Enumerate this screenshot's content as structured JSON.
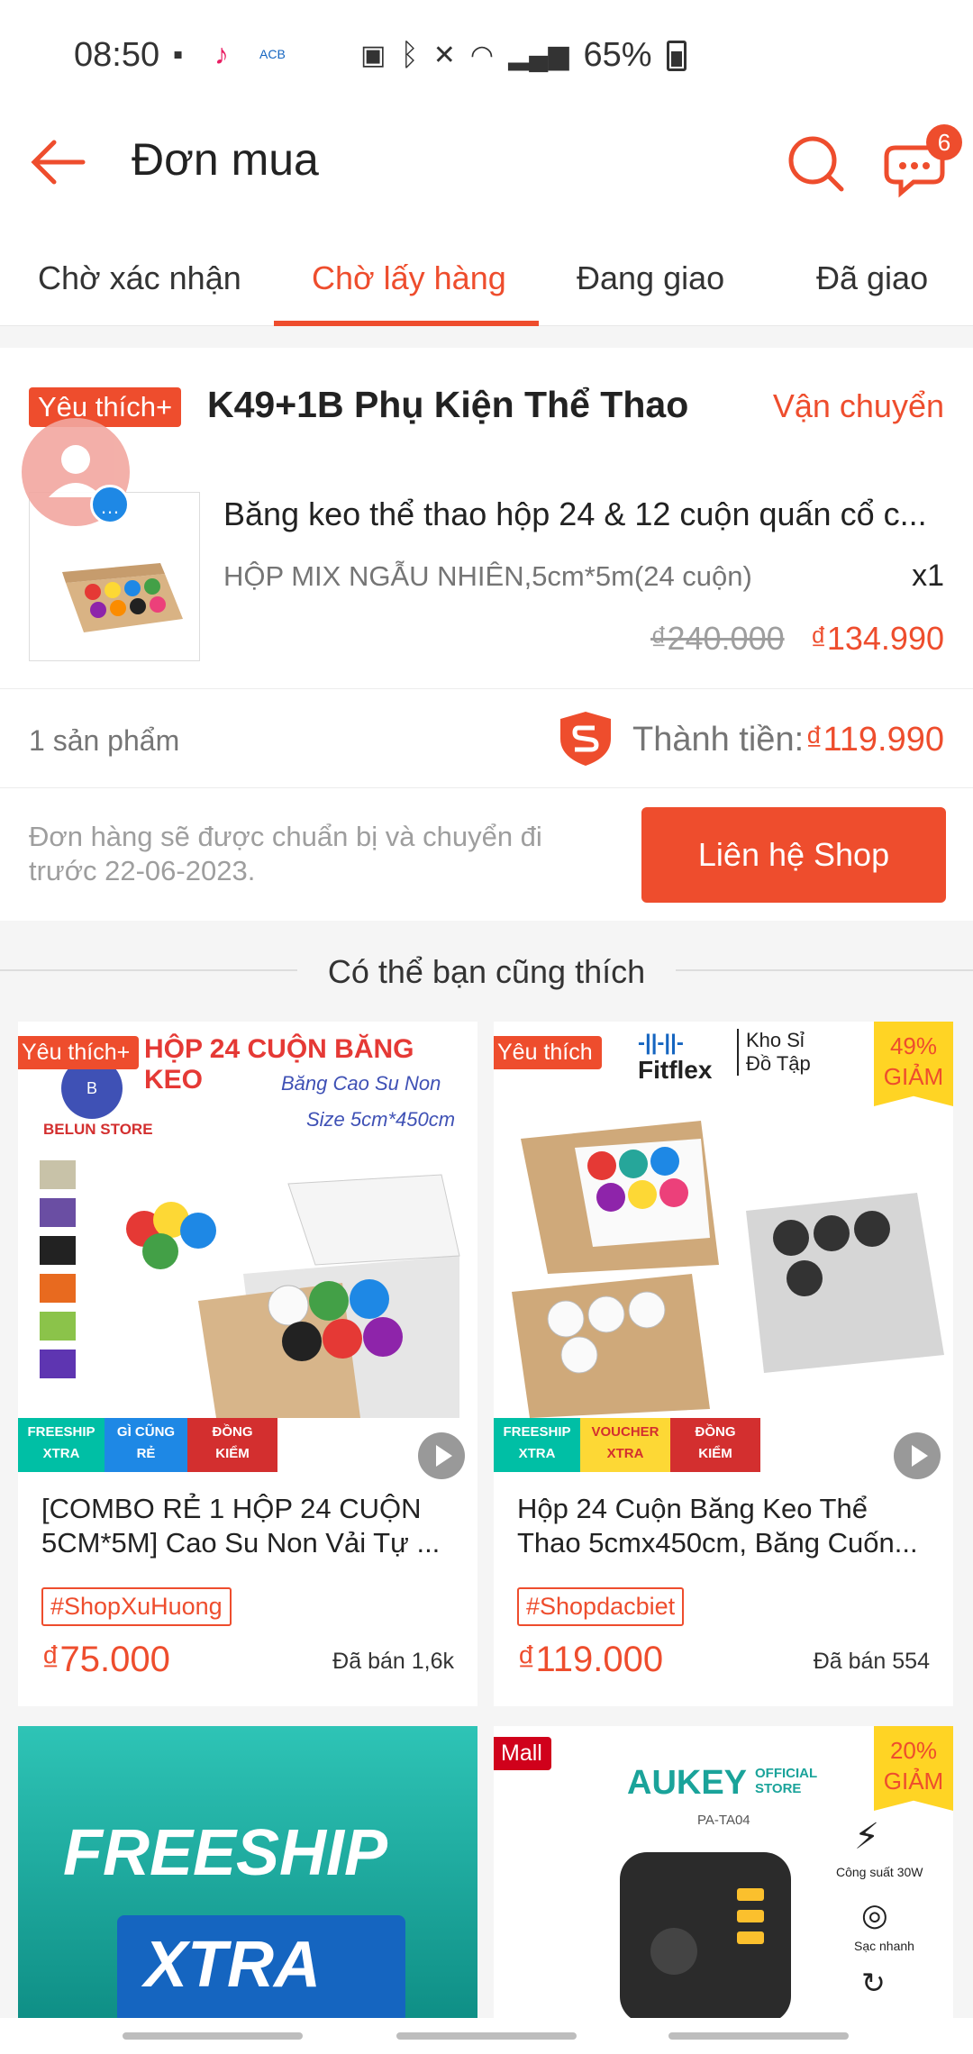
{
  "status_bar": {
    "time": "08:50",
    "battery": "65%"
  },
  "header": {
    "title": "Đơn mua",
    "chat_badge": "6"
  },
  "tabs": [
    {
      "label": "Chờ xác nhận"
    },
    {
      "label": "Chờ lấy hàng"
    },
    {
      "label": "Đang giao"
    },
    {
      "label": "Đã giao"
    }
  ],
  "order": {
    "shop_badge": "Yêu thích+",
    "shop_name": "K49+1B Phụ Kiện Thể Thao",
    "status": "Vận chuyển",
    "product_name": "Băng keo thể thao hộp 24 & 12 cuộn quấn cổ c...",
    "variant": "HỘP MIX NGẪU NHIÊN,5cm*5m(24 cuộn)",
    "quantity": "x1",
    "old_price": "₫240.000",
    "price": "₫134.990",
    "item_count": "1 sản phẩm",
    "total_label": "Thành tiền:",
    "total_value": "₫119.990",
    "note": "Đơn hàng sẽ được chuẩn bị và chuyển đi trước 22-06-2023.",
    "contact_button": "Liên hệ Shop"
  },
  "recommend": {
    "title": "Có thể bạn cũng thích",
    "items": [
      {
        "badge": "Yêu thích+",
        "image_header": "HỘP 24 CUỘN BĂNG KEO",
        "image_sub": "Băng Cao Su Non",
        "image_size": "Size 5cm*450cm",
        "image_store": "BELUN STORE",
        "strip": [
          "FREESHIP XTRA",
          "GÌ CŨNG RẺ",
          "ĐỒNG KIỂM"
        ],
        "title": "[COMBO RẺ 1 HỘP 24 CUỘN 5CM*5M]  Cao Su Non Vải Tự ...",
        "tag": "#ShopXuHuong",
        "price": "₫75.000",
        "sold": "Đã bán 1,6k"
      },
      {
        "badge": "Yêu thích",
        "discount": "49% GIẢM",
        "image_brand": "Fitflex",
        "image_sub": "Kho Sỉ Đồ Tập",
        "strip": [
          "FREESHIP XTRA",
          "VOUCHER XTRA",
          "ĐỒNG KIỂM"
        ],
        "title": "Hộp 24 Cuộn Băng Keo Thể Thao 5cmx450cm, Băng Cuốn...",
        "tag": "#Shopdacbiet",
        "price": "₫119.000",
        "sold": "Đã bán 554"
      },
      {
        "banner_line1": "FREESHIP",
        "banner_line2": "XTRA"
      },
      {
        "badge": "Mall",
        "discount": "20% GIẢM",
        "image_brand": "AUKEY",
        "image_store": "OFFICIAL STORE",
        "image_model": "PA-TA04",
        "feature1": "Công suất 30W",
        "feature2": "Sạc nhanh"
      }
    ]
  },
  "colors": {
    "accent": "#ee4d2d",
    "discount_bg": "#ffd424"
  }
}
